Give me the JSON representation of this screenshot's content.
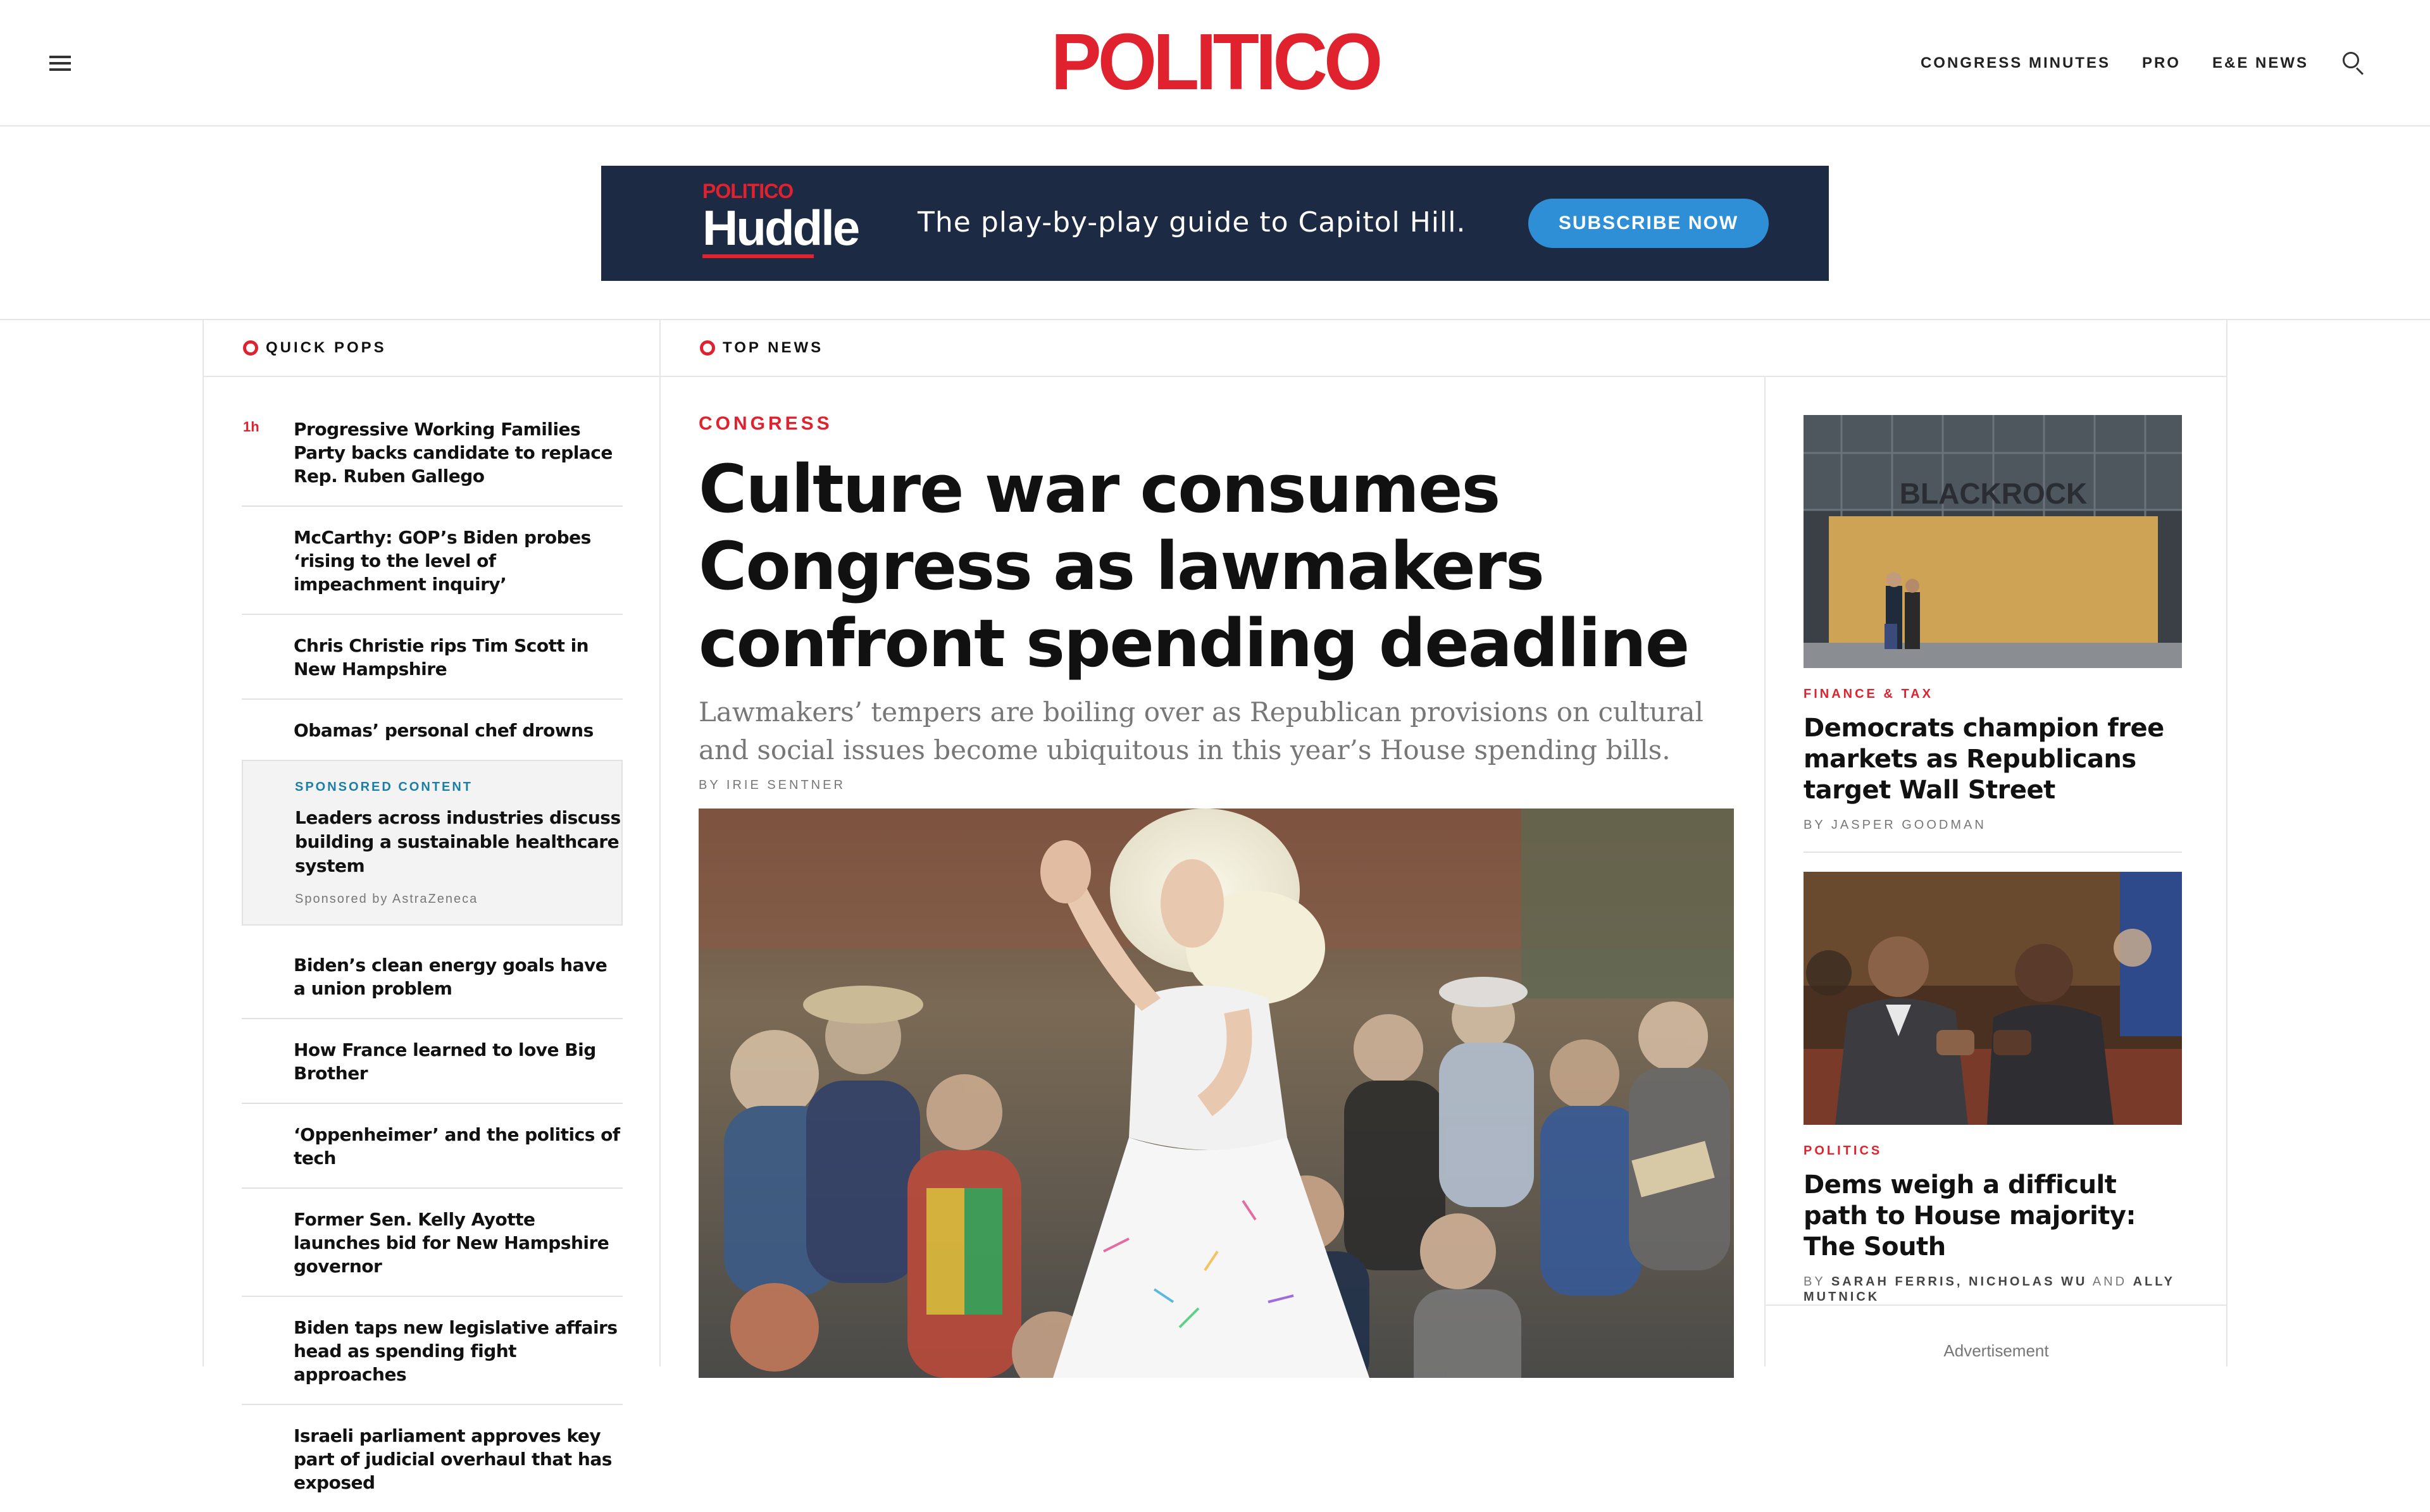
{
  "header": {
    "logo": "POLITICO",
    "nav": [
      "CONGRESS MINUTES",
      "PRO",
      "E&E NEWS"
    ]
  },
  "banner": {
    "brand_top": "POLITICO",
    "brand_word": "Huddle",
    "tagline": "The play-by-play guide to Capitol Hill.",
    "cta": "SUBSCRIBE NOW"
  },
  "quick_pops": {
    "label": "QUICK POPS",
    "items": [
      {
        "time": "1h",
        "title": "Progressive Working Families Party backs candidate to replace Rep. Ruben Gallego"
      },
      {
        "time": "",
        "title": "McCarthy: GOP’s Biden probes ‘rising to the level of impeachment inquiry’"
      },
      {
        "time": "",
        "title": "Chris Christie rips Tim Scott in New Hampshire"
      },
      {
        "time": "",
        "title": "Obamas’ personal chef drowns"
      }
    ],
    "sponsored": {
      "tag": "SPONSORED CONTENT",
      "title": "Leaders across industries discuss building a sustainable healthcare system",
      "by": "Sponsored by AstraZeneca"
    },
    "items2": [
      {
        "title": "Biden’s clean energy goals have a union problem"
      },
      {
        "title": "How France learned to love Big Brother"
      },
      {
        "title": "‘Oppenheimer’ and the politics of tech"
      },
      {
        "title": "Former Sen. Kelly Ayotte launches bid for New Hampshire governor"
      },
      {
        "title": "Biden taps new legislative affairs head as spending fight approaches"
      },
      {
        "title": "Israeli parliament approves key part of judicial overhaul that has exposed"
      }
    ]
  },
  "top_news": {
    "label": "TOP NEWS",
    "lead": {
      "kicker": "CONGRESS",
      "headline": "Culture war consumes Congress as lawmakers confront spending deadline",
      "dek": "Lawmakers’ tempers are boiling over as Republican provisions on cultural and social issues become ubiquitous in this year’s House spending bills.",
      "by_prefix": "BY",
      "author": "IRIE SENTNER"
    },
    "side": [
      {
        "kicker": "FINANCE & TAX",
        "title": "Democrats champion free markets as Republicans target Wall Street",
        "by_prefix": "BY",
        "authors": "JASPER GOODMAN",
        "and": "",
        "authors2": "",
        "photo_sign": "BLACKROCK"
      },
      {
        "kicker": "POLITICS",
        "title": "Dems weigh a difficult path to House majority: The South",
        "by_prefix": "BY",
        "authors": "SARAH FERRIS, NICHOLAS WU",
        "and": "AND",
        "authors2": "ALLY MUTNICK"
      }
    ],
    "ad_label": "Advertisement"
  },
  "colors": {
    "brand_red": "#e0222f",
    "banner_navy": "#1c2a44",
    "cta_blue": "#2e8fd7",
    "sponsored_teal": "#1b7fa3"
  }
}
